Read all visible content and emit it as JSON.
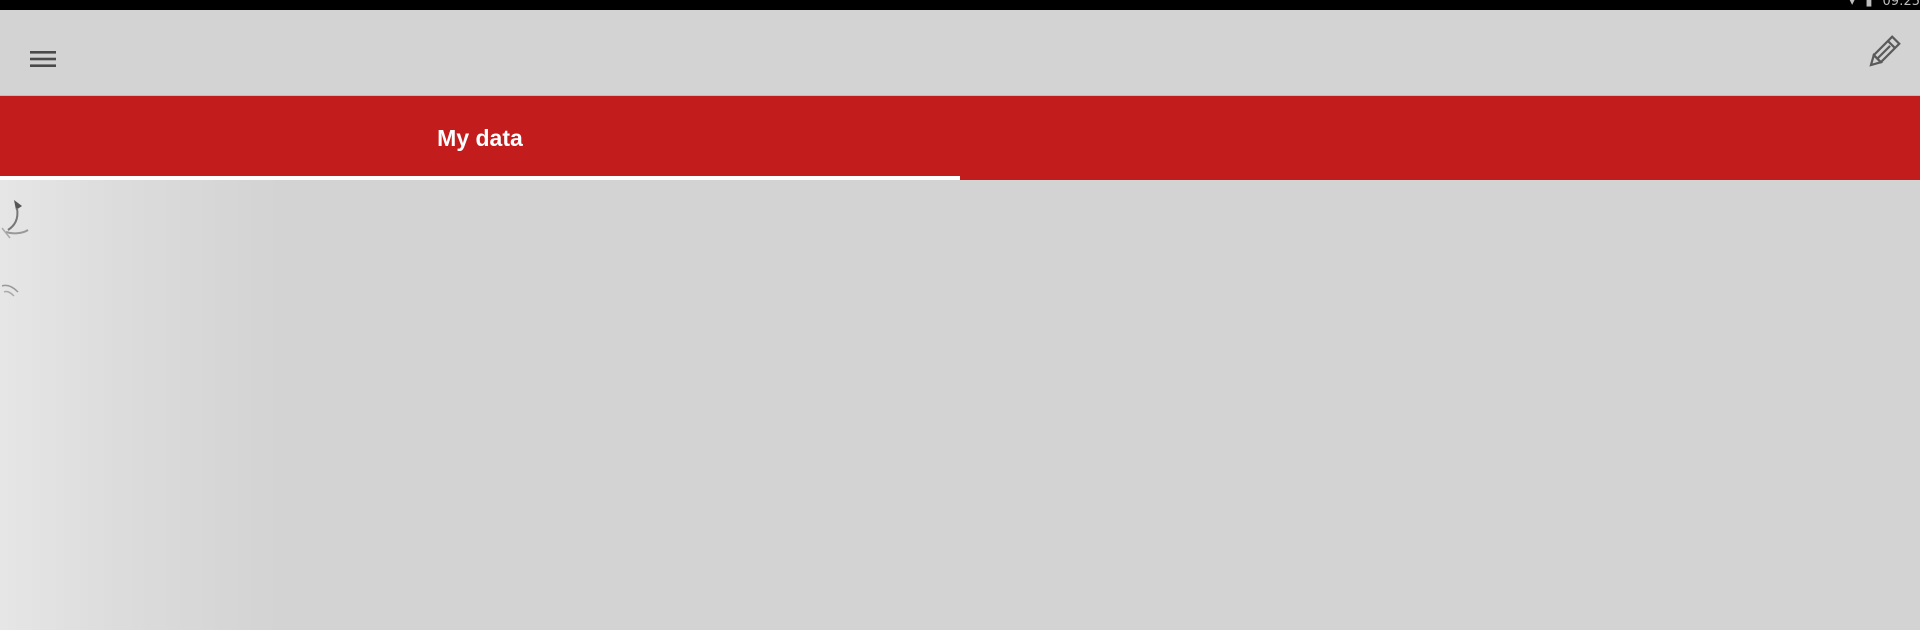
{
  "status_bar": {
    "time": "09:25"
  },
  "toolbar": {
    "menu_icon": "hamburger-menu-icon",
    "edit_icon": "pencil-icon"
  },
  "tabs": [
    {
      "label": "My data",
      "active": true
    },
    {
      "label": "",
      "active": false
    }
  ],
  "colors": {
    "accent": "#c21c1c",
    "background": "#d3d3d3",
    "indicator": "#ffffff"
  }
}
